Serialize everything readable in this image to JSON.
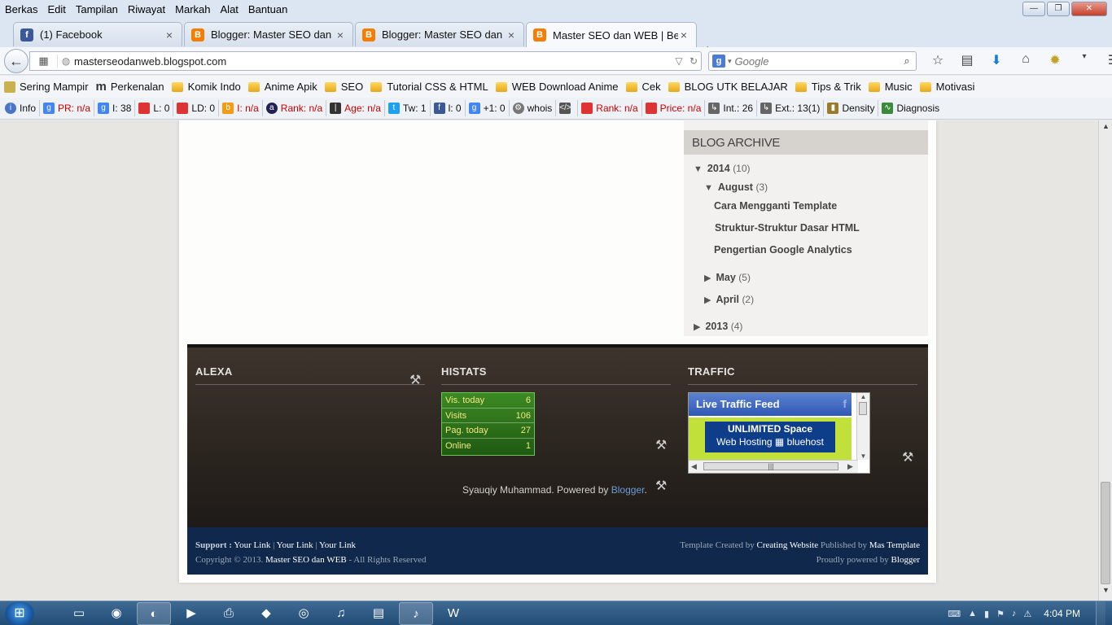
{
  "menubar": {
    "items": [
      "Berkas",
      "Edit",
      "Tampilan",
      "Riwayat",
      "Markah",
      "Alat",
      "Bantuan"
    ]
  },
  "tabs": [
    {
      "title": "(1) Facebook",
      "icon": "facebook-icon"
    },
    {
      "title": "Blogger: Master SEO dan ...",
      "icon": "blogger-icon"
    },
    {
      "title": "Blogger: Master SEO dan ...",
      "icon": "blogger-icon"
    },
    {
      "title": "Master SEO dan WEB | Bela...",
      "icon": "blogger-icon",
      "active": true
    }
  ],
  "navbar": {
    "url": "masterseodanweb.blogspot.com",
    "search_placeholder": "Google"
  },
  "bookmarks": [
    "Sering Mampir",
    "Perkenalan",
    "Komik Indo",
    "Anime Apik",
    "SEO",
    "Tutorial CSS & HTML",
    "WEB Download Anime",
    "Cek",
    "BLOG UTK BELAJAR",
    "Tips & Trik",
    "Music",
    "Motivasi"
  ],
  "seobar": [
    {
      "label": "Info"
    },
    {
      "label": "PR: n/a",
      "red": true
    },
    {
      "label": "I: 38"
    },
    {
      "label": "L: 0"
    },
    {
      "label": "LD: 0"
    },
    {
      "label": "I: n/a",
      "red": true
    },
    {
      "label": "Rank: n/a",
      "red": true
    },
    {
      "label": "Age: n/a",
      "red": true
    },
    {
      "label": "Tw: 1"
    },
    {
      "label": "l: 0"
    },
    {
      "label": "+1: 0"
    },
    {
      "label": "whois"
    },
    {
      "label": ""
    },
    {
      "label": "Rank: n/a",
      "red": true
    },
    {
      "label": "Price: n/a",
      "red": true
    },
    {
      "label": "Int.: 26"
    },
    {
      "label": "Ext.: 13(1)"
    },
    {
      "label": "Density"
    },
    {
      "label": "Diagnosis"
    }
  ],
  "archive": {
    "title": "BLOG ARCHIVE",
    "year_2014": {
      "label": "2014",
      "count": "(10)"
    },
    "august": {
      "label": "August",
      "count": "(3)"
    },
    "posts": [
      "Cara Mengganti Template",
      "Struktur-Struktur Dasar HTML",
      "Pengertian Google Analytics"
    ],
    "may": {
      "label": "May",
      "count": "(5)"
    },
    "april": {
      "label": "April",
      "count": "(2)"
    },
    "year_2013": {
      "label": "2013",
      "count": "(4)"
    }
  },
  "footer": {
    "alexa_title": "ALEXA",
    "histats_title": "HISTATS",
    "traffic_title": "TRAFFIC",
    "histats_rows": [
      {
        "label": "Vis. today",
        "value": "6"
      },
      {
        "label": "Visits",
        "value": "106"
      },
      {
        "label": "Pag. today",
        "value": "27"
      },
      {
        "label": "Online",
        "value": "1"
      }
    ],
    "ltf_title": "Live Traffic Feed",
    "ad_line1": "UNLIMITED Space",
    "ad_line2_a": "Web Hosting",
    "ad_line2_b": "bluehost",
    "powered_text": "Syauqiy Muhammad. Powered by",
    "powered_link": "Blogger",
    "powered_dot": "."
  },
  "bottom": {
    "support_label": "Support :",
    "links": [
      "Your Link",
      "Your Link",
      "Your Link"
    ],
    "sep": "|",
    "copyright_prefix": "Copyright © 2013.",
    "site_name": "Master SEO dan WEB",
    "rights": "- All Rights Reserved",
    "template_by": "Template Created by",
    "creator": "Creating Website",
    "published_by": "Published by",
    "publisher": "Mas Template",
    "proudly": "Proudly powered by",
    "platform": "Blogger"
  },
  "taskbar": {
    "clock": "4:04 PM"
  },
  "colors": {
    "tab_bg": "#dce6f2",
    "footer_dark": "#2a241f",
    "footer_blue": "#10284b",
    "histats_green": "#2f7a1c",
    "link_blue": "#6b9bd6"
  }
}
